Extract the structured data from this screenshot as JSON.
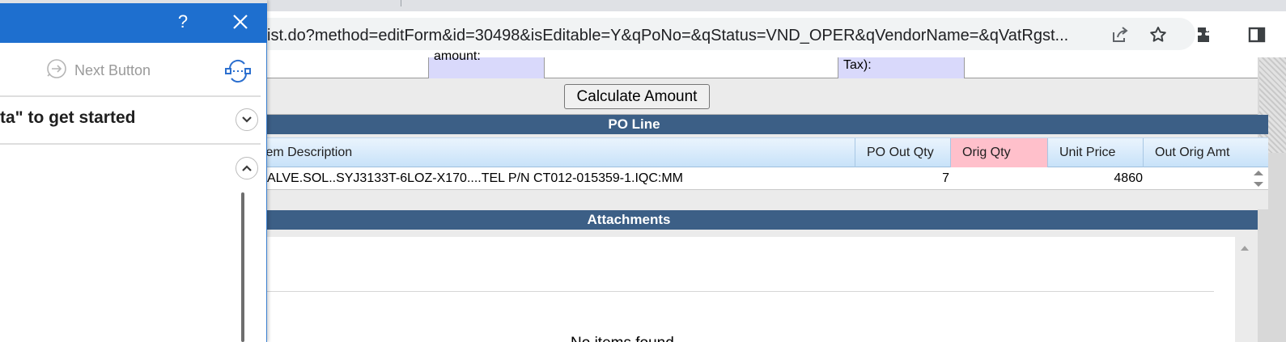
{
  "browser": {
    "url": "ist.do?method=editForm&id=30498&isEditable=Y&qPoNo=&qStatus=VND_OPER&qVendorName=&qVatRgst...",
    "icons": [
      "share-icon",
      "bookmark-star-icon",
      "extensions-icon",
      "side-panel-icon"
    ]
  },
  "form": {
    "amount_label_fragment": "amount:",
    "tax_label_fragment": "Tax):",
    "calculate_button": "Calculate Amount"
  },
  "po_line": {
    "section_title": "PO Line",
    "columns": [
      "tem Description",
      "PO Out Qty",
      "Orig Qty",
      "Unit Price",
      "Out Orig Amt"
    ],
    "rows": [
      {
        "item_description": "ALVE.SOL..SYJ3133T-6LOZ-X170....TEL P/N CT012-015359-1.IQC:MM",
        "po_out_qty": "7",
        "orig_qty": "",
        "unit_price": "4860",
        "out_orig_amt": ""
      }
    ]
  },
  "attachments": {
    "section_title": "Attachments",
    "empty_text": "No items found"
  },
  "panel": {
    "help_label": "?",
    "next_button_label": "Next Button",
    "get_started_text": "ta\" to get started",
    "colors": {
      "title_bar": "#1e6fcf",
      "section_bar": "#3c5f86",
      "orig_qty_header": "#ffc0cb"
    }
  }
}
